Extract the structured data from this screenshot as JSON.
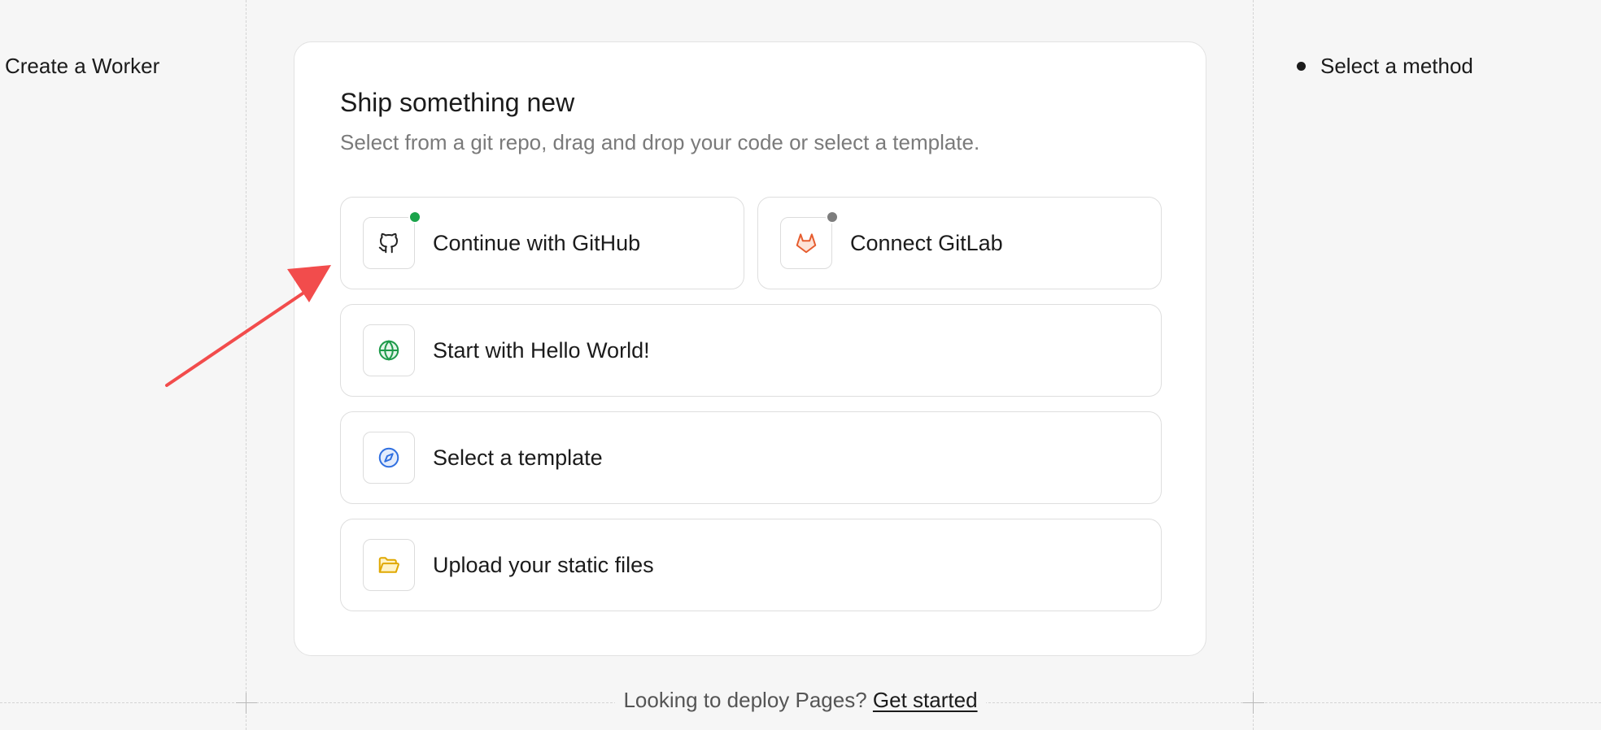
{
  "header": {
    "left_title": "Create a Worker"
  },
  "steps": [
    {
      "label": "Select a method"
    }
  ],
  "card": {
    "title": "Ship something new",
    "subtitle": "Select from a git repo, drag and drop your code or select a template."
  },
  "options": {
    "github": {
      "label": "Continue with GitHub",
      "icon": "github-icon",
      "status": "connected"
    },
    "gitlab": {
      "label": "Connect GitLab",
      "icon": "gitlab-icon",
      "status": "disconnected"
    },
    "hello_world": {
      "label": "Start with Hello World!",
      "icon": "globe-icon"
    },
    "template": {
      "label": "Select a template",
      "icon": "compass-icon"
    },
    "upload": {
      "label": "Upload your static files",
      "icon": "folder-icon"
    }
  },
  "footer": {
    "text": "Looking to deploy Pages?",
    "link": "Get started"
  },
  "colors": {
    "connected": "#1aa34a",
    "disconnected": "#7d7d7d",
    "gitlab_orange": "#e65c2e",
    "globe_green": "#1e9a4a",
    "compass_blue": "#2f6fe0",
    "folder_yellow": "#e0a800",
    "annotation_arrow": "#f24c4c"
  }
}
